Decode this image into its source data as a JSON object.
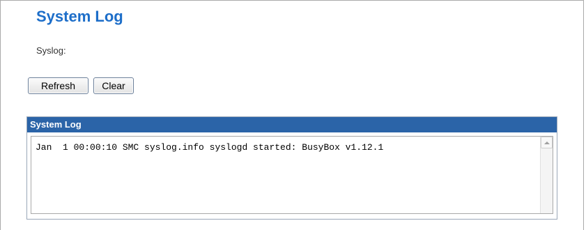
{
  "page": {
    "title": "System Log",
    "syslog_label": "Syslog:"
  },
  "buttons": {
    "refresh": "Refresh",
    "clear": "Clear"
  },
  "panel": {
    "header": "System Log",
    "log_content": "Jan  1 00:00:10 SMC syslog.info syslogd started: BusyBox v1.12.1"
  },
  "icons": {
    "scroll_up": "chevron-up-icon"
  },
  "colors": {
    "title": "#1d6ec9",
    "panel_header_bg": "#2b64a8",
    "panel_header_text": "#ffffff"
  }
}
